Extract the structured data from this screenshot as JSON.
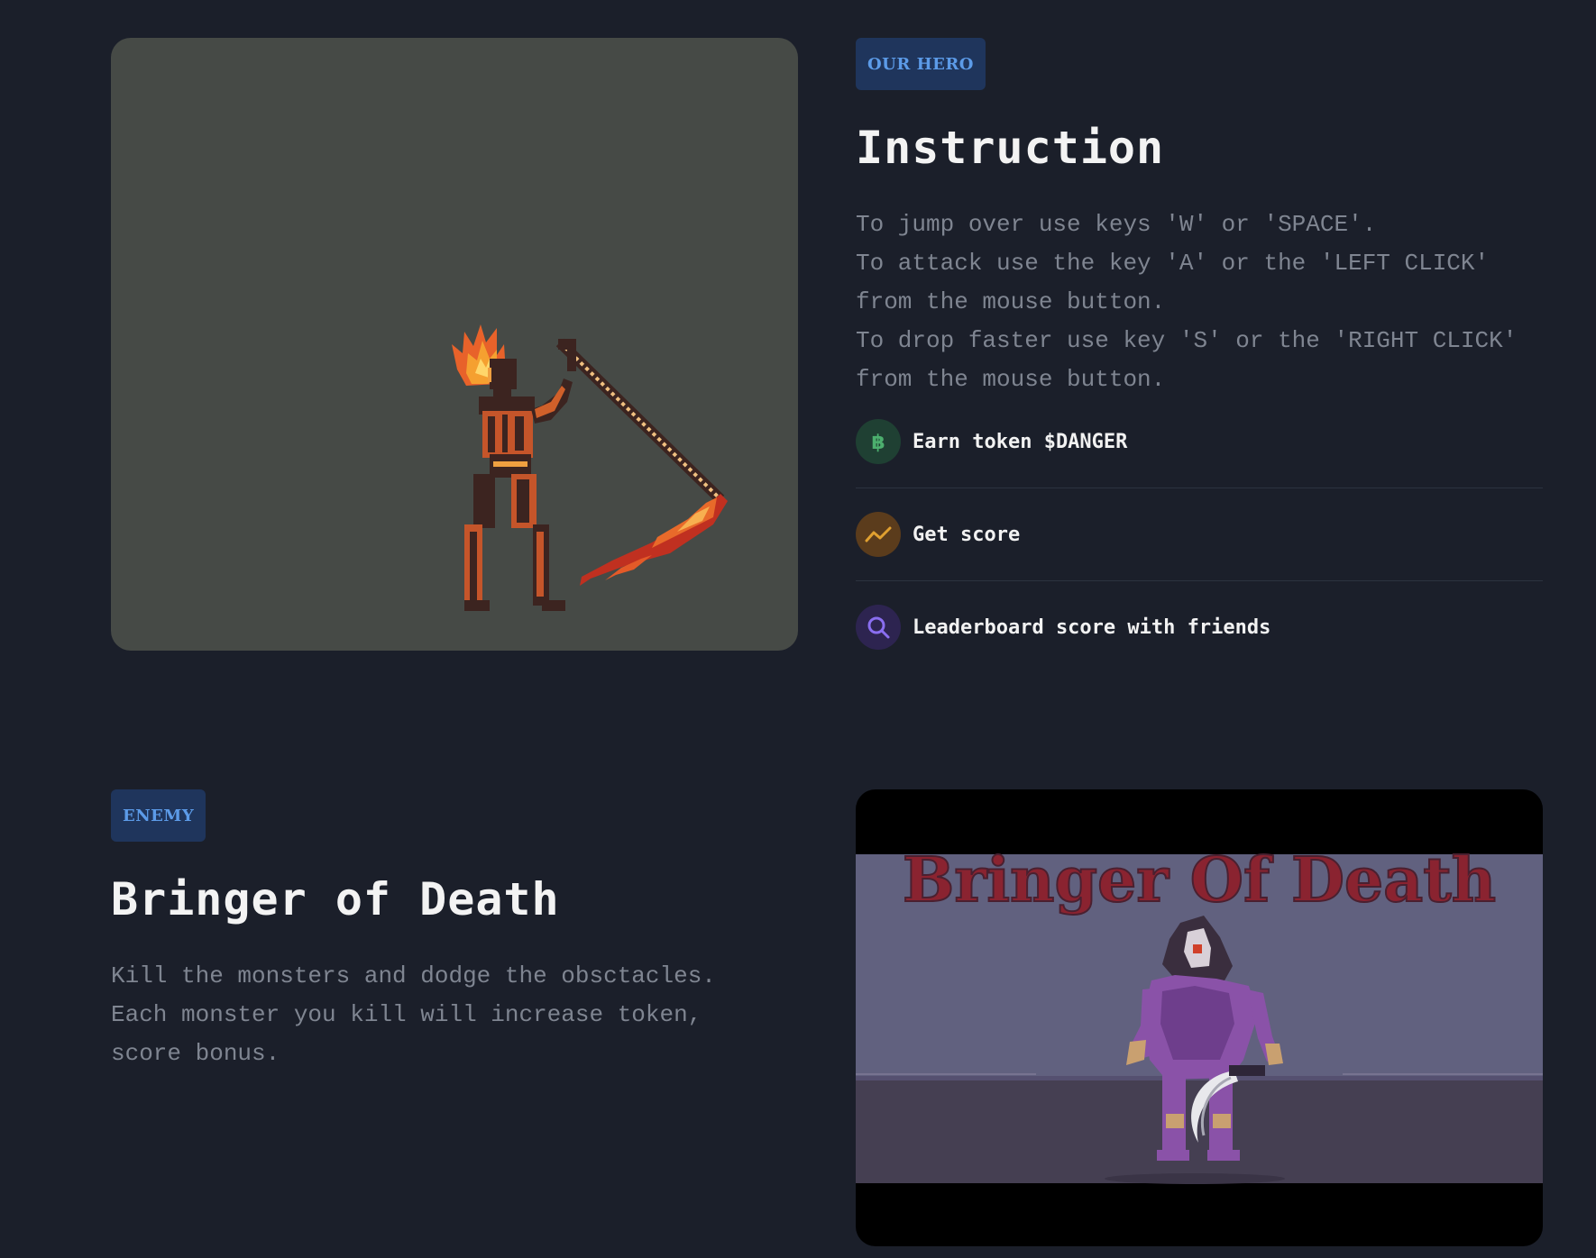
{
  "hero": {
    "tag": "OUR HERO",
    "title": "Instruction",
    "description": "To jump over use keys 'W' or 'SPACE'.\nTo attack use the key 'A' or the 'LEFT CLICK' from the mouse button.\nTo drop faster use key 'S' or the 'RIGHT CLICK' from the mouse button.",
    "image_icon": "fire-skeleton-hero-sprite",
    "features": [
      {
        "icon": "bitcoin-icon",
        "label": "Earn token $DANGER",
        "color": "#4caf6e"
      },
      {
        "icon": "trend-chart-icon",
        "label": "Get score",
        "color": "#e0a030"
      },
      {
        "icon": "search-icon",
        "label": "Leaderboard score with friends",
        "color": "#8a6ef0"
      }
    ]
  },
  "enemy": {
    "tag": "ENEMY",
    "title": "Bringer of Death",
    "description": "Kill the monsters and dodge the obsctacles.\nEach monster you kill will increase token,\nscore bonus.",
    "banner_text": "Bringer Of Death",
    "image_icon": "reaper-enemy-sprite"
  },
  "colors": {
    "background": "#1b1f2a",
    "tag_bg": "#1f355c",
    "tag_text": "#5c9be8",
    "muted_text": "#7f8591",
    "heading_text": "#f3f3f3"
  }
}
